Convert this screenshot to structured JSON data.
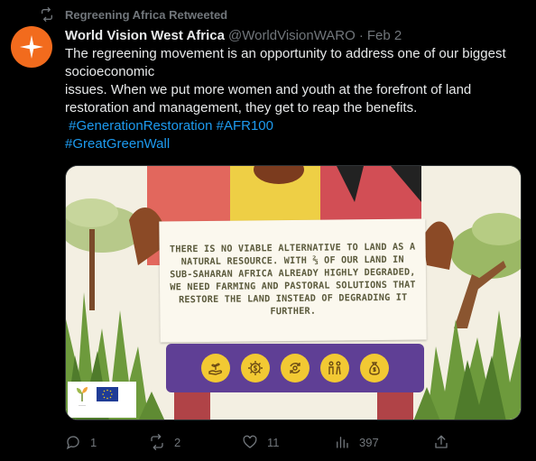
{
  "retweet_notice": {
    "text": "Regreening Africa Retweeted",
    "icon": "retweet-icon"
  },
  "tweet": {
    "author_name": "World Vision West Africa",
    "handle": "@WorldVisionWARO",
    "separator": "·",
    "date": "Feb 2",
    "text_lines": [
      "The regreening movement is an opportunity to address one of our biggest",
      "socioeconomic",
      "issues. When we put more women and youth at the forefront of land",
      "restoration and management, they get to reap the benefits."
    ],
    "hashtags_line1": [
      " #GenerationRestoration",
      "#AFR100"
    ],
    "hashtags_line2": [
      "#GreatGreenWall"
    ]
  },
  "media": {
    "banner_text": "There is no viable alternative to land as a natural resource. With ⅔ of our land in sub-Saharan Africa already highly degraded, we need farming and pastoral solutions that restore the land instead of degrading it further.",
    "icons": [
      "hand-plant-icon",
      "money-gear-icon",
      "recycle-icon",
      "people-icon",
      "money-bag-icon"
    ],
    "colors": {
      "banner_strip": "#5f3f95",
      "badge": "#f2c933",
      "avatar": "#f26b1d"
    }
  },
  "actions": {
    "replies": "1",
    "retweets": "2",
    "likes": "11",
    "views": "397"
  }
}
